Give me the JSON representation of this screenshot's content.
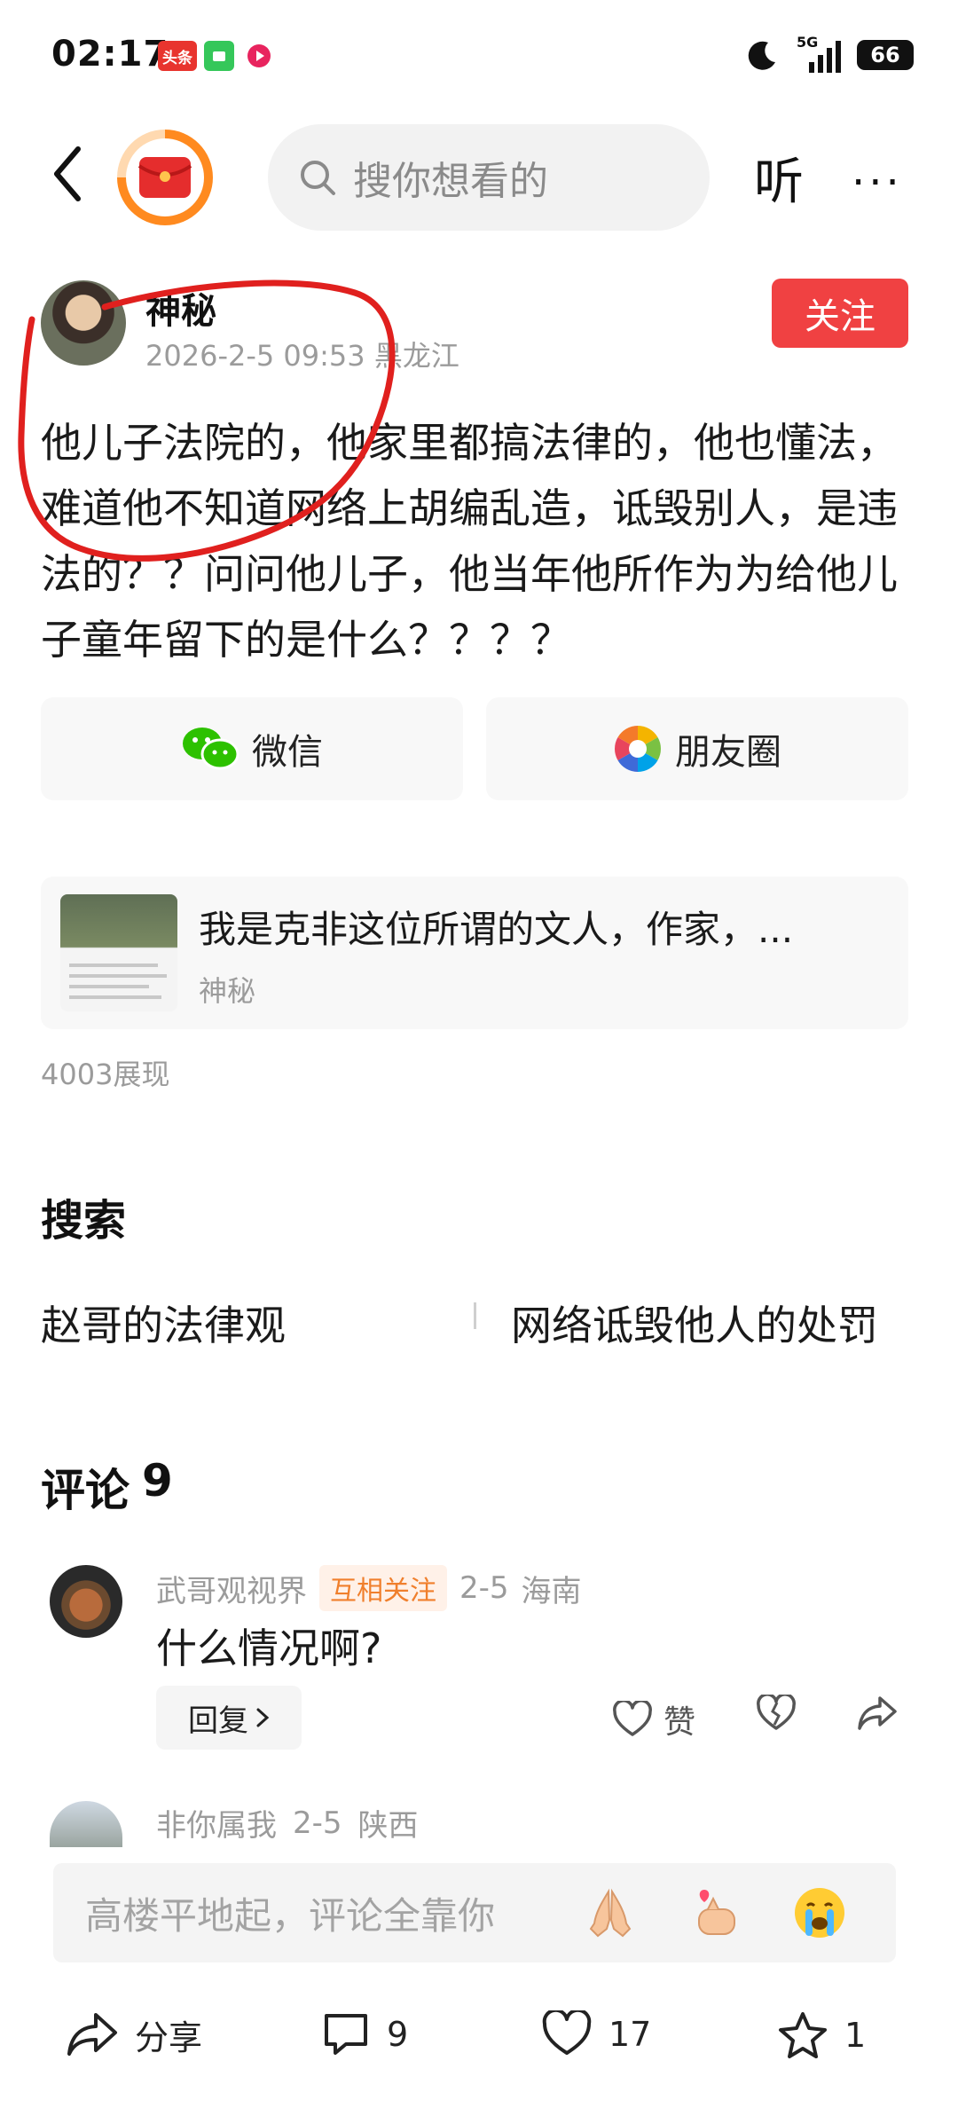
{
  "status_bar": {
    "time": "02:17",
    "app_badge_label": "头条",
    "network": "5G",
    "battery": "66"
  },
  "nav": {
    "search_placeholder": "搜你想看的",
    "listen_label": "听",
    "more_label": "···"
  },
  "author": {
    "name": "神秘",
    "meta": "2026-2-5 09:53 黑龙江",
    "follow_label": "关注"
  },
  "post": {
    "text": "他儿子法院的，他家里都搞法律的，他也懂法，难道他不知道网络上胡编乱造，诋毁别人，是违法的？？问问他儿子，他当年他所作为为给他儿子童年留下的是什么？？？？"
  },
  "share": {
    "wechat_label": "微信",
    "moments_label": "朋友圈"
  },
  "quoted": {
    "title": "我是克非这位所谓的文人，作家，...",
    "author": "神秘"
  },
  "views": "4003展现",
  "search_section": {
    "heading": "搜索",
    "suggestions": [
      "赵哥的法律观",
      "网络诋毁他人的处罚"
    ]
  },
  "comments_section": {
    "heading": "评论",
    "count": "9",
    "items": [
      {
        "user": "武哥观视界",
        "badge": "互相关注",
        "date": "2-5",
        "location": "海南",
        "text": "什么情况啊?",
        "reply_label": "回复",
        "like_label": "赞"
      },
      {
        "user": "非你属我",
        "date": "2-5",
        "location": "陕西"
      }
    ]
  },
  "comment_input": {
    "placeholder": "高楼平地起，评论全靠你"
  },
  "toolbar": {
    "share_label": "分享",
    "comment_count": "9",
    "like_count": "17",
    "fav_count": "1"
  },
  "colors": {
    "accent_red": "#f04142",
    "annotation_red": "#e0201e",
    "badge_orange": "#f07f2c"
  }
}
